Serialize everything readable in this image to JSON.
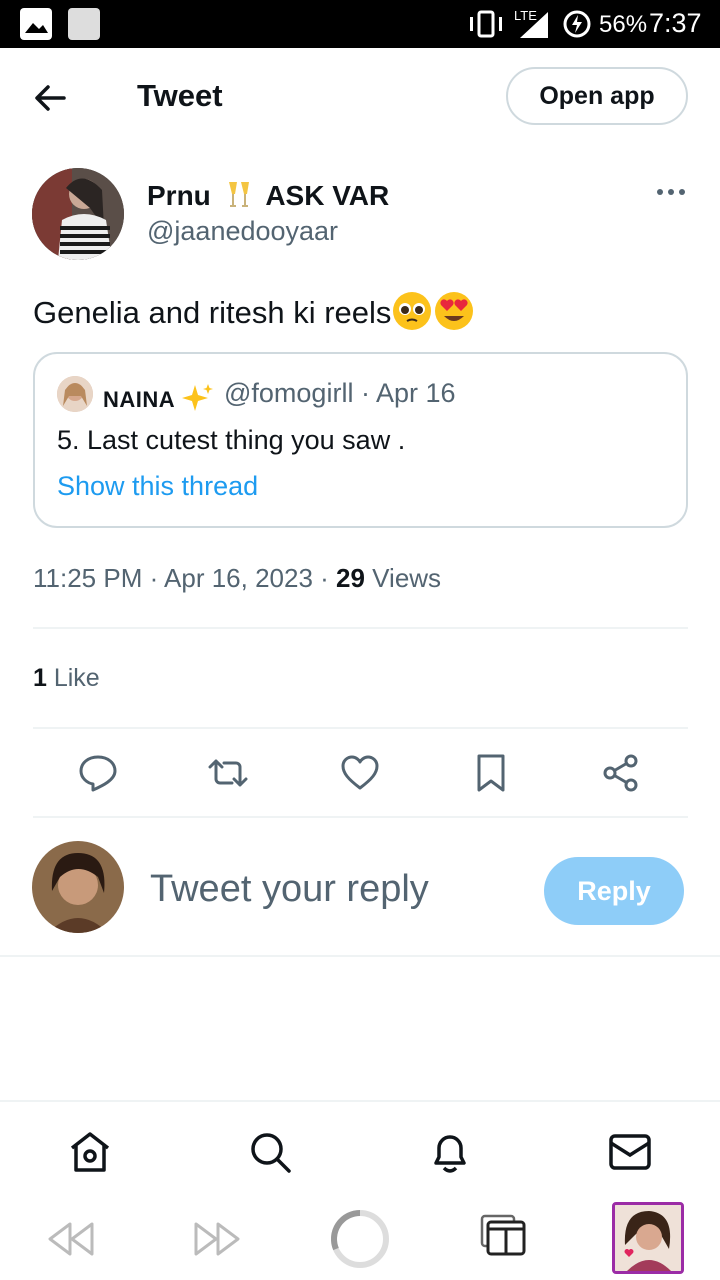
{
  "status_bar": {
    "battery": "56%",
    "time": "7:37",
    "network": "LTE"
  },
  "header": {
    "title": "Tweet",
    "open_app_label": "Open app"
  },
  "tweet": {
    "author_name": "Prnu",
    "author_name_suffix": "ASK VAR",
    "handle": "@jaanedooyaar",
    "text": "Genelia and ritesh ki reels",
    "emojis": [
      "pleading-face",
      "heart-eyes-face"
    ],
    "timestamp": "11:25 PM · Apr 16, 2023 · ",
    "views_count": "29",
    "views_label": " Views",
    "likes_count": "1",
    "likes_label": " Like"
  },
  "quote": {
    "name": "NAINA",
    "meta": "@fomogirll · Apr 16",
    "text": "5. Last cutest thing you saw .",
    "show_thread": "Show this thread"
  },
  "reply": {
    "placeholder": "Tweet your reply",
    "button_label": "Reply"
  },
  "colors": {
    "accent": "#1d9bf0",
    "reply_disabled": "#8ecdf8",
    "secondary_text": "#536471",
    "border": "#cfd9de"
  }
}
